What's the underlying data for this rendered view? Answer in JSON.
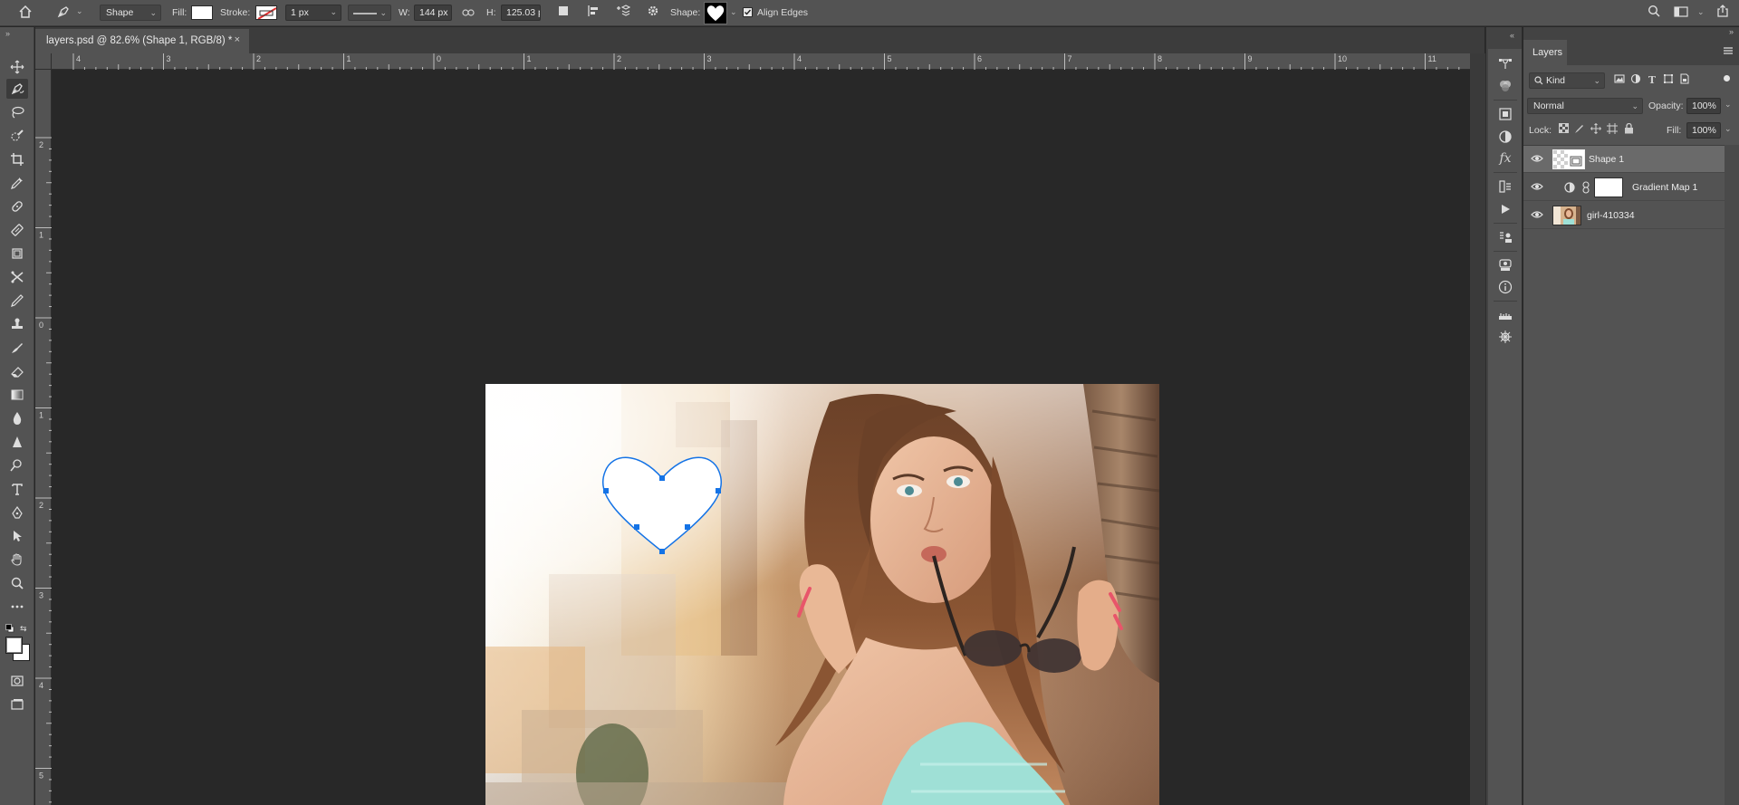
{
  "options_bar": {
    "home_icon": "home-icon",
    "tool_preset_icon": "pen-tool-icon",
    "mode": "Shape",
    "fill_label": "Fill:",
    "stroke_label": "Stroke:",
    "stroke_width": "1 px",
    "w_label": "W:",
    "w_value": "144 px",
    "h_label": "H:",
    "h_value": "125.03 p",
    "shape_label": "Shape:",
    "align_edges_label": "Align Edges",
    "align_edges_checked": true
  },
  "document": {
    "tab_title": "layers.psd @ 82.6% (Shape 1, RGB/8) *",
    "close_symbol": "×"
  },
  "rulers": {
    "horizontal": [
      "4",
      "3",
      "2",
      "1",
      "0",
      "1",
      "2",
      "3",
      "4",
      "5",
      "6",
      "7",
      "8",
      "9",
      "10",
      "11"
    ],
    "vertical": [
      "2",
      "1",
      "0",
      "1",
      "2",
      "3",
      "4",
      "5"
    ]
  },
  "layers_panel": {
    "tab_label": "Layers",
    "kind_label": "Kind",
    "blend_mode": "Normal",
    "opacity_label": "Opacity:",
    "opacity_value": "100%",
    "lock_label": "Lock:",
    "fill_label": "Fill:",
    "fill_value": "100%",
    "layers": [
      {
        "name": "Shape 1",
        "selected": true
      },
      {
        "name": "Gradient Map 1",
        "selected": false
      },
      {
        "name": "girl-410334",
        "selected": false
      }
    ]
  },
  "colors": {
    "accent": "#1473e6",
    "panel_bg": "#535353",
    "canvas_bg": "#282828"
  }
}
